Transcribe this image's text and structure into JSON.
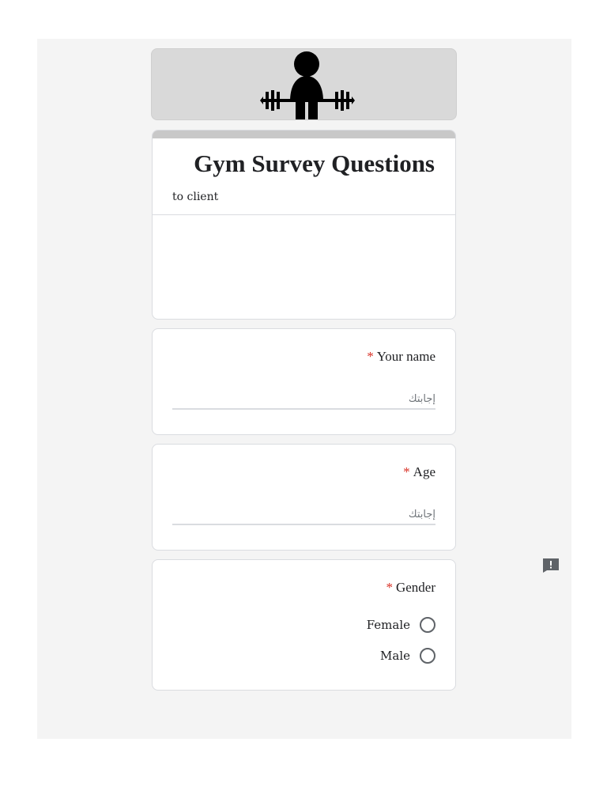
{
  "form": {
    "title": "Gym Survey Questions",
    "description": "to client",
    "header_image": "weightlifter-icon"
  },
  "questions": [
    {
      "title": "Your name",
      "required_marker": "*",
      "placeholder": "إجابتك"
    },
    {
      "title": "Age",
      "required_marker": "*",
      "placeholder": "إجابتك"
    },
    {
      "title": "Gender",
      "required_marker": "*",
      "options": [
        "Female",
        "Male"
      ]
    }
  ],
  "report_icon": "report-problem-icon",
  "colors": {
    "required": "#d93025",
    "page_background": "#f4f4f4",
    "header_banner": "#d9d9d9"
  }
}
